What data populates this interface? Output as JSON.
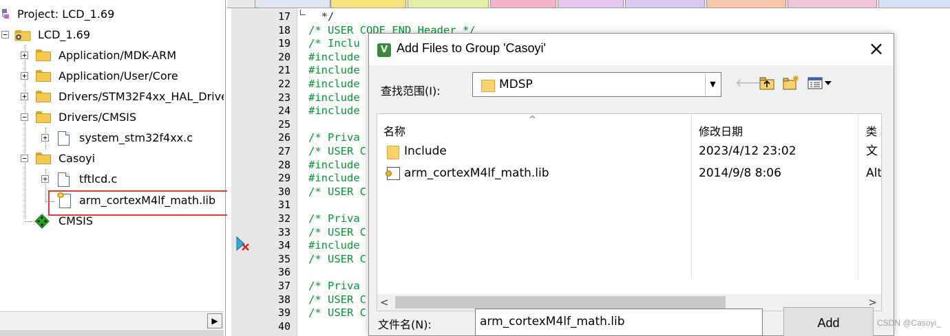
{
  "project_tree": {
    "title": "Project: LCD_1.69",
    "target": "LCD_1.69",
    "groups": [
      {
        "label": "Application/MDK-ARM"
      },
      {
        "label": "Application/User/Core"
      },
      {
        "label": "Drivers/STM32F4xx_HAL_Drive"
      },
      {
        "label": "Drivers/CMSIS"
      },
      {
        "label": "system_stm32f4xx.c"
      },
      {
        "label": "Casoyi"
      },
      {
        "label": "tftlcd.c"
      },
      {
        "label": "arm_cortexM4lf_math.lib"
      },
      {
        "label": "CMSIS"
      }
    ],
    "highlight_color": "#e53935"
  },
  "editor": {
    "lines": [
      {
        "n": "17",
        "text": "  */"
      },
      {
        "n": "18",
        "text": "/* USER CODE END Header */"
      },
      {
        "n": "19",
        "text": "/* Inclu"
      },
      {
        "n": "20",
        "text": "#include"
      },
      {
        "n": "21",
        "text": "#include"
      },
      {
        "n": "22",
        "text": "#include"
      },
      {
        "n": "23",
        "text": "#include"
      },
      {
        "n": "24",
        "text": "#include"
      },
      {
        "n": "25",
        "text": ""
      },
      {
        "n": "26",
        "text": "/* Priva"
      },
      {
        "n": "27",
        "text": "/* USER C"
      },
      {
        "n": "28",
        "text": "#include"
      },
      {
        "n": "29",
        "text": "#include"
      },
      {
        "n": "30",
        "text": "/* USER C"
      },
      {
        "n": "31",
        "text": ""
      },
      {
        "n": "32",
        "text": "/* Priva"
      },
      {
        "n": "33",
        "text": "/* USER C"
      },
      {
        "n": "34",
        "text": "#include"
      },
      {
        "n": "35",
        "text": "/* USER C"
      },
      {
        "n": "36",
        "text": ""
      },
      {
        "n": "37",
        "text": "/* Priva"
      },
      {
        "n": "38",
        "text": "/* USER C"
      },
      {
        "n": "39",
        "text": "/* USER C"
      },
      {
        "n": "40",
        "text": ""
      }
    ],
    "comment_color": "#009933"
  },
  "dialog": {
    "title": "Add Files to Group 'Casoyi'",
    "app_icon": "V",
    "close": "×",
    "look_in_label": "查找范围(I):",
    "look_in_value": "MDSP",
    "columns": {
      "name": "名称",
      "date": "修改日期",
      "type": "类"
    },
    "files": [
      {
        "name": "Include",
        "date": "2023/4/12 23:02",
        "type": "文",
        "icon": "folder-icon"
      },
      {
        "name": "arm_cortexM4lf_math.lib",
        "date": "2014/9/8 8:06",
        "type": "Alt",
        "icon": "lib-file-icon"
      }
    ],
    "file_name_label": "文件名(N):",
    "file_name_value": "arm_cortexM4lf_math.lib",
    "add_button": "Add"
  },
  "watermark": "CSDN @Casoyi_"
}
